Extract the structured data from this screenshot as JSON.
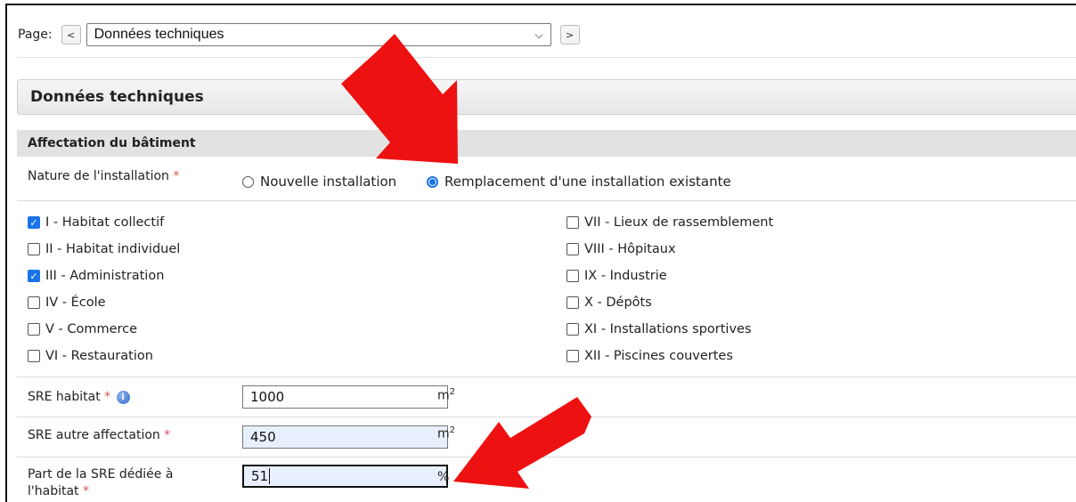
{
  "nav": {
    "page_label": "Page:",
    "prev_label": "<",
    "next_label": ">",
    "select_value": "Données techniques"
  },
  "panel": {
    "title": "Données techniques"
  },
  "section": {
    "title": "Affectation du bâtiment"
  },
  "nature": {
    "label": "Nature de l'installation",
    "required_mark": "*",
    "options": [
      {
        "label": "Nouvelle installation",
        "selected": false
      },
      {
        "label": "Remplacement d'une installation existante",
        "selected": true
      }
    ]
  },
  "categories": {
    "left": [
      {
        "label": "I - Habitat collectif",
        "checked": true
      },
      {
        "label": "II - Habitat individuel",
        "checked": false
      },
      {
        "label": "III - Administration",
        "checked": true
      },
      {
        "label": "IV - École",
        "checked": false
      },
      {
        "label": "V - Commerce",
        "checked": false
      },
      {
        "label": "VI - Restauration",
        "checked": false
      }
    ],
    "right": [
      {
        "label": "VII - Lieux de rassemblement",
        "checked": false
      },
      {
        "label": "VIII - Hôpitaux",
        "checked": false
      },
      {
        "label": "IX - Industrie",
        "checked": false
      },
      {
        "label": "X - Dépôts",
        "checked": false
      },
      {
        "label": "XI - Installations sportives",
        "checked": false
      },
      {
        "label": "XII - Piscines couvertes",
        "checked": false
      }
    ]
  },
  "fields": {
    "sre_habitat": {
      "label": "SRE habitat",
      "required_mark": "*",
      "value": "1000",
      "unit": "m",
      "unit_sup": "2",
      "icon": "info-icon"
    },
    "sre_autre": {
      "label": "SRE autre affectation",
      "required_mark": "*",
      "value": "450",
      "unit": "m",
      "unit_sup": "2"
    },
    "part_sre": {
      "label_line1": "Part de la SRE dédiée à",
      "label_line2": "l'habitat",
      "required_mark": "*",
      "value": "51",
      "unit": "%"
    }
  },
  "colors": {
    "accent": "#1a73e8",
    "arrow": "#ee1111",
    "required": "#d9534f"
  }
}
